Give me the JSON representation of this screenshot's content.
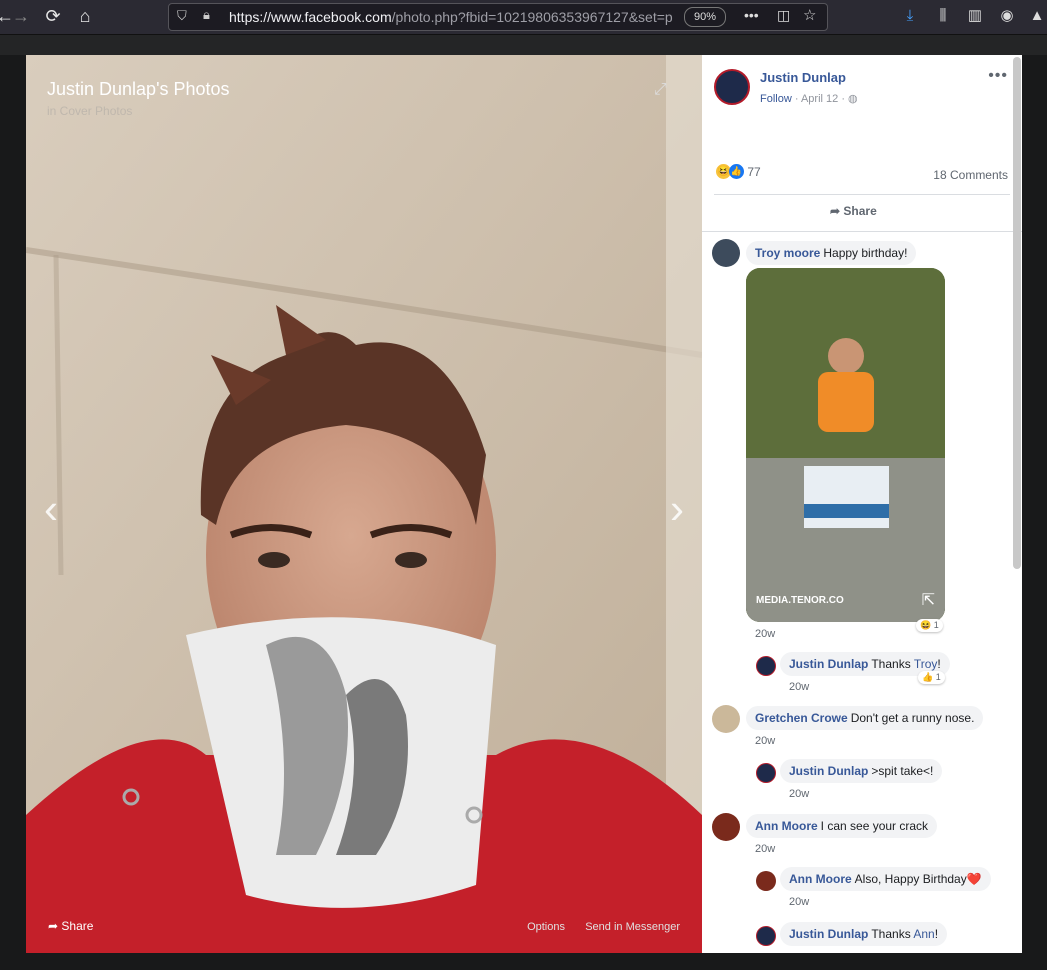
{
  "browser": {
    "url_domain": "https://www.facebook.com",
    "url_rest": "/photo.php?fbid=10219806353967127&set=p",
    "zoom": "90%"
  },
  "photo": {
    "title": "Justin Dunlap's Photos",
    "subtitle": "in Cover Photos",
    "share_label": "Share",
    "options_label": "Options",
    "messenger_label": "Send in Messenger"
  },
  "post": {
    "author": "Justin Dunlap",
    "follow": "Follow",
    "date": "April 12",
    "reaction_count": "77",
    "comments_count": "18 Comments",
    "share_label": "Share"
  },
  "comments": [
    {
      "name": "Troy moore",
      "text": "Happy birthday!",
      "gif_label": "MEDIA.TENOR.CO",
      "reaction": "1",
      "time": "20w"
    },
    {
      "name": "Justin Dunlap",
      "text": "Thanks ",
      "mention": "Troy",
      "tail": "!",
      "reaction": "1",
      "time": "20w"
    },
    {
      "name": "Gretchen Crowe",
      "text": "Don't get a runny nose.",
      "time": "20w"
    },
    {
      "name": "Justin Dunlap",
      "text": ">spit take<!",
      "time": "20w"
    },
    {
      "name": "Ann Moore",
      "text": "I can see your crack",
      "time": "20w"
    },
    {
      "name": "Ann Moore",
      "text": "Also, Happy Birthday",
      "emoji": "❤️",
      "time": "20w"
    },
    {
      "name": "Justin Dunlap",
      "text": "Thanks ",
      "mention": "Ann",
      "tail": "!"
    }
  ]
}
